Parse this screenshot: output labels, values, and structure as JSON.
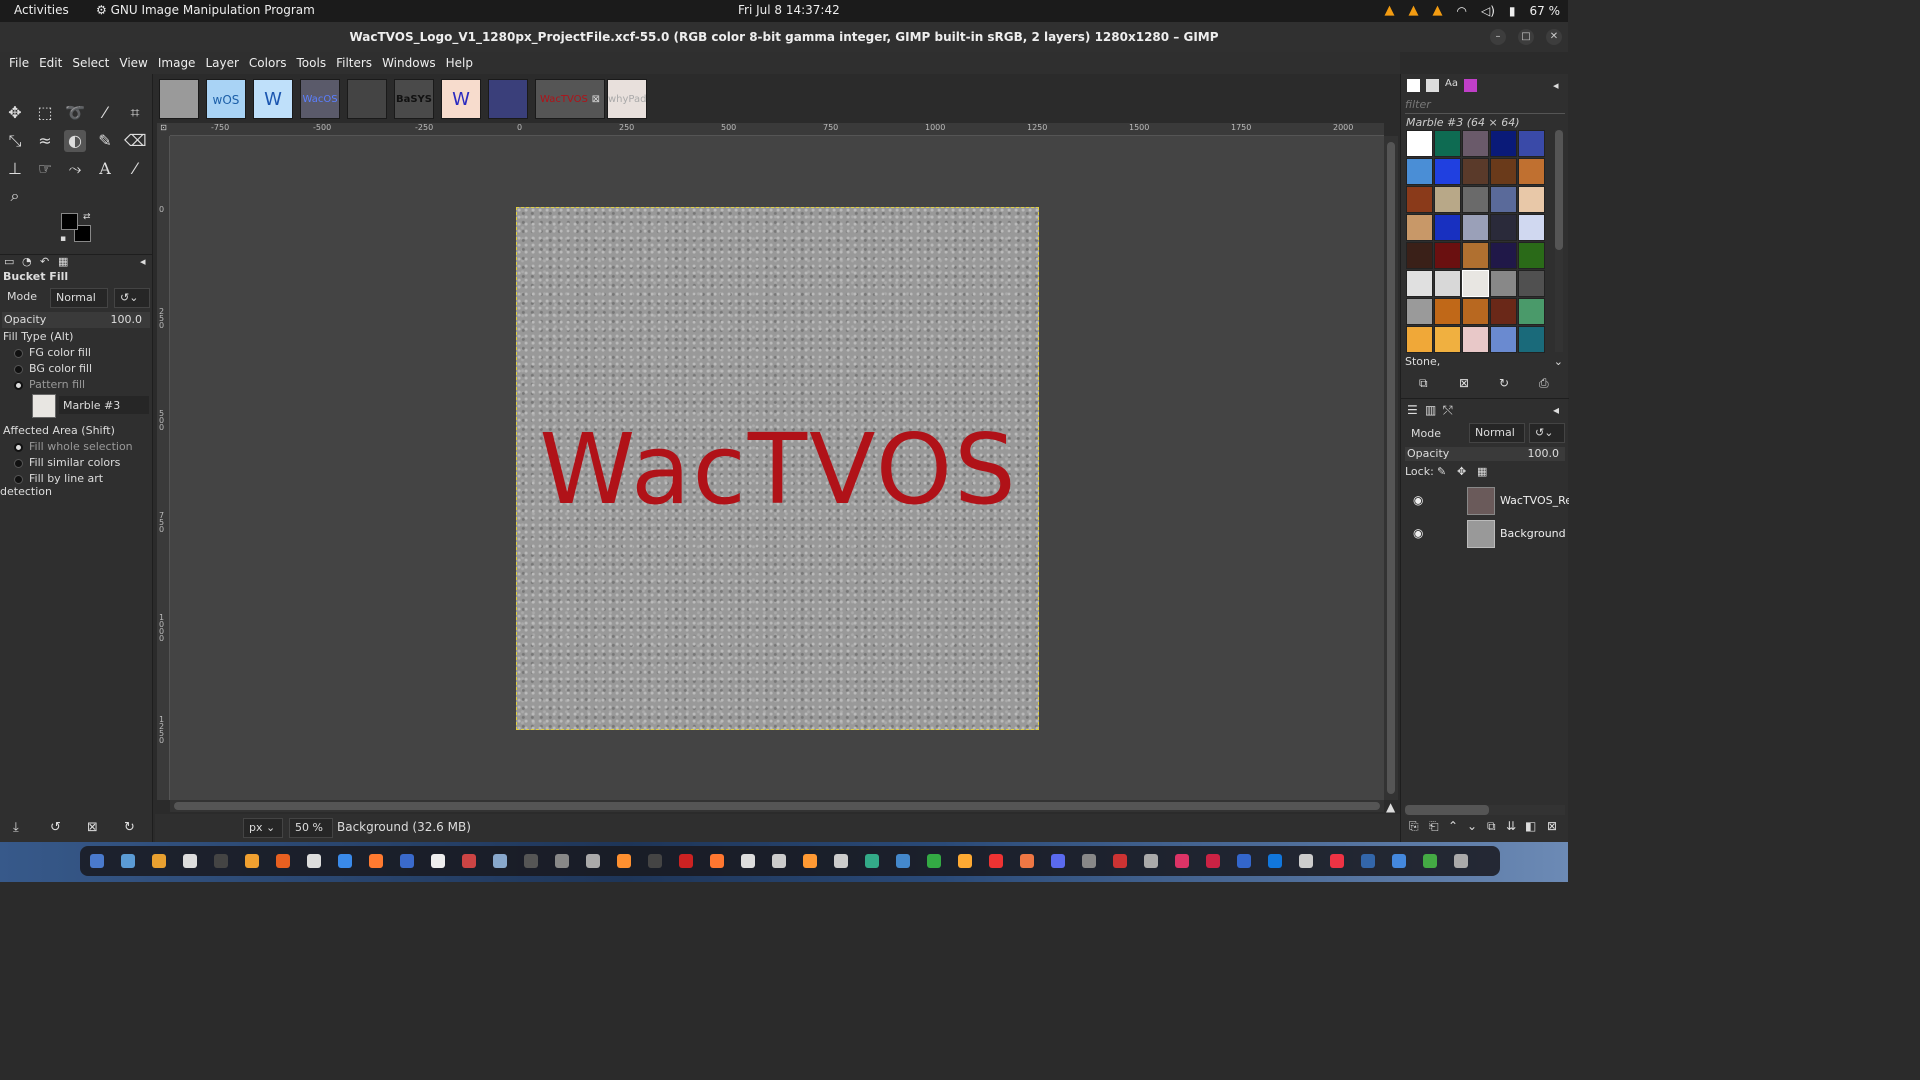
{
  "topbar": {
    "activities": "Activities",
    "app": "GNU Image Manipulation Program",
    "clock": "Fri Jul 8  14:37:42",
    "battery": "67 %"
  },
  "window": {
    "title": "WacTVOS_Logo_V1_1280px_ProjectFile.xcf-55.0 (RGB color 8-bit gamma integer, GIMP built-in sRGB, 2 layers) 1280x1280 – GIMP"
  },
  "menu": [
    "File",
    "Edit",
    "Select",
    "View",
    "Image",
    "Layer",
    "Colors",
    "Tools",
    "Filters",
    "Windows",
    "Help"
  ],
  "tool_options": {
    "title": "Bucket Fill",
    "mode_label": "Mode",
    "mode_value": "Normal",
    "opacity_label": "Opacity",
    "opacity_value": "100.0",
    "fill_type_label": "Fill Type  (Alt)",
    "fill_types": [
      "FG color fill",
      "BG color fill",
      "Pattern fill"
    ],
    "selected_fill_type": "Pattern fill",
    "pattern_name": "Marble #3",
    "affected_label": "Affected Area  (Shift)",
    "affected_options": [
      "Fill whole selection",
      "Fill similar colors",
      "Fill by line art detection"
    ],
    "selected_affected": "Fill whole selection"
  },
  "image_tabs": [
    "",
    "wOS",
    "W",
    "WacOS",
    "",
    "BaSYS",
    "W",
    "",
    "WacTVOS",
    "whyPadOS"
  ],
  "active_tab": "WacTVOS",
  "hruler_labels": [
    "-750",
    "-500",
    "-250",
    "0",
    "250",
    "500",
    "750",
    "1000",
    "1250",
    "1500",
    "1750",
    "2000"
  ],
  "vruler_labels": [
    "0",
    "250",
    "500",
    "750",
    "1000",
    "1250"
  ],
  "canvas": {
    "logo_text": "WacTVOS",
    "logo_color": "#b01218"
  },
  "status": {
    "unit": "px",
    "zoom": "50 %",
    "message": "Background (32.6 MB)"
  },
  "patterns": {
    "filter_placeholder": "filter",
    "selected_label": "Marble #3 (64 × 64)",
    "tag": "Stone,"
  },
  "layers": {
    "mode_label": "Mode",
    "mode_value": "Normal",
    "opacity_label": "Opacity",
    "opacity_value": "100.0",
    "lock_label": "Lock:",
    "items": [
      {
        "name": "WacTVOS_Rec"
      },
      {
        "name": "Background"
      }
    ]
  }
}
